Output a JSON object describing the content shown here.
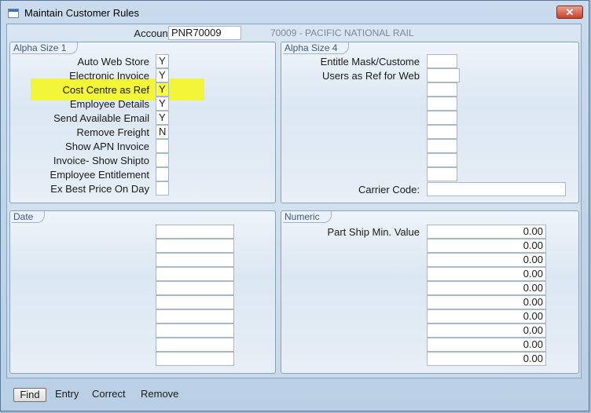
{
  "window": {
    "title": "Maintain Customer Rules",
    "close_label": "✕"
  },
  "account": {
    "label": "Account:",
    "value": "PNR70009",
    "description": "70009 - PACIFIC NATIONAL RAIL"
  },
  "alpha1": {
    "title": "Alpha Size 1",
    "rows": [
      {
        "label": "Auto Web Store",
        "value": "Y"
      },
      {
        "label": "Electronic Invoice",
        "value": "Y"
      },
      {
        "label": "Cost Centre as Ref",
        "value": "Y"
      },
      {
        "label": "Employee Details",
        "value": "Y"
      },
      {
        "label": "Send Available Email",
        "value": "Y"
      },
      {
        "label": "Remove Freight",
        "value": "N"
      },
      {
        "label": "Show APN Invoice",
        "value": ""
      },
      {
        "label": "Invoice- Show Shipto",
        "value": ""
      },
      {
        "label": "Employee Entitlement",
        "value": ""
      },
      {
        "label": "Ex Best Price On Day",
        "value": ""
      }
    ]
  },
  "alpha4": {
    "title": "Alpha Size 4",
    "rows": [
      {
        "label": "Entitle Mask/Custome",
        "value": ""
      },
      {
        "label": "Users as Ref for Web",
        "value": ""
      }
    ],
    "carrier_label": "Carrier Code:",
    "carrier_value": ""
  },
  "date": {
    "title": "Date"
  },
  "numeric": {
    "title": "Numeric",
    "first_label": "Part Ship Min. Value",
    "values": [
      "0.00",
      "0.00",
      "0.00",
      "0.00",
      "0.00",
      "0.00",
      "0.00",
      "0.00",
      "0.00",
      "0.00"
    ]
  },
  "actions": {
    "find": "Find",
    "entry": "Entry",
    "correct": "Correct",
    "remove": "Remove"
  },
  "colors": {
    "highlight": "#f2f437",
    "panel_title": "#3d5a84",
    "close": "#c7422b"
  }
}
